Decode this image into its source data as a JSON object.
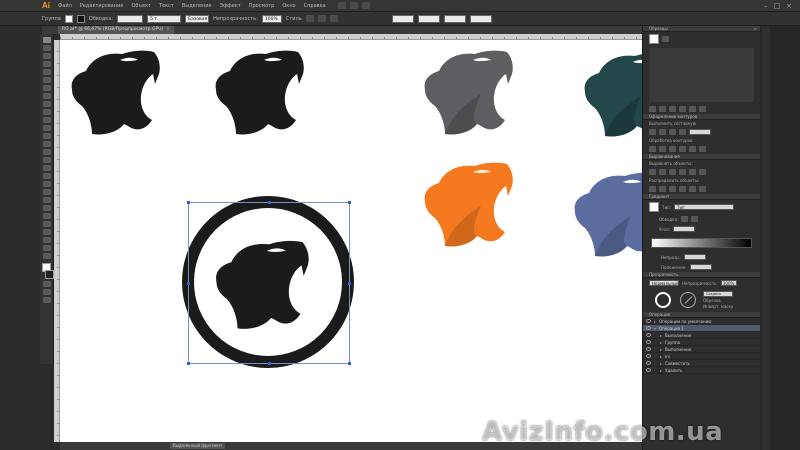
{
  "app": {
    "logo": "Ai"
  },
  "menu": [
    "Файл",
    "Редактирование",
    "Объект",
    "Текст",
    "Выделение",
    "Эффект",
    "Просмотр",
    "Окно",
    "Справка"
  ],
  "controlbar": {
    "group_label": "Группа",
    "stroke_label": "Обводка:",
    "brush_value": "5 т. Круглая",
    "style_label": "Базовая",
    "opacity_label": "Непрозрачность:",
    "opacity_value": "100%",
    "style_tag": "Стиль"
  },
  "document": {
    "tab_title": "RG ar* @ 66,67% (RGB/Предпросмотр GPU)",
    "close": "×"
  },
  "status": {
    "tool": "Выделенный фрагмент"
  },
  "panels": {
    "swatches": {
      "title": "Образцы",
      "menu": "≡"
    },
    "libraries": {
      "title": "Оформление контуров",
      "label": "Выполнить составную"
    },
    "shapes": {
      "title": "Обработка контуров"
    },
    "align": {
      "title": "Выравнивание",
      "label": "Выровнять объекты:",
      "distribute": "Распределить объекты:"
    },
    "gradient": {
      "title": "Градиент",
      "type_label": "Тип:",
      "type_value": "Тип",
      "stroke_label": "Обводка:",
      "angle_label": "Угол:",
      "opacity_label": "Непрозр.:",
      "location_label": "Положение:"
    },
    "transparency": {
      "title": "Прозрачность",
      "mode_value": "Нормальный",
      "opacity_label": "Непрозрачность:",
      "opacity_value": "100%",
      "make_mask": "Создать маску",
      "clip": "Обрезка",
      "invert": "Инверт. маску"
    },
    "layers": {
      "title": "Операции",
      "rows": [
        {
          "label": "Операции по умолчанию",
          "active": false
        },
        {
          "label": "Операция 1",
          "active": true
        },
        {
          "label": "Выполнение",
          "active": false
        },
        {
          "label": "Группа",
          "active": false
        },
        {
          "label": "Выполнение",
          "active": false
        },
        {
          "label": "Ini",
          "active": false
        },
        {
          "label": "Совместить",
          "active": false
        },
        {
          "label": "Удалить",
          "active": false
        }
      ]
    }
  },
  "canvas": {
    "panthers": [
      {
        "color": "#1b1b1b"
      },
      {
        "color": "#1b1b1b"
      },
      {
        "color": "#5e5e62"
      },
      {
        "color": "#24474a"
      },
      {
        "color": "#f57a1f"
      },
      {
        "color": "#5a6d9e"
      },
      {
        "color": "#1b1b1b"
      }
    ],
    "ring_color": "#1b1b1b"
  },
  "watermark": "AvizInfo.com.ua",
  "colors": {
    "accent": "#f2a11c",
    "selection": "#2f5fd6",
    "ui_bg": "#2b2b2b"
  }
}
